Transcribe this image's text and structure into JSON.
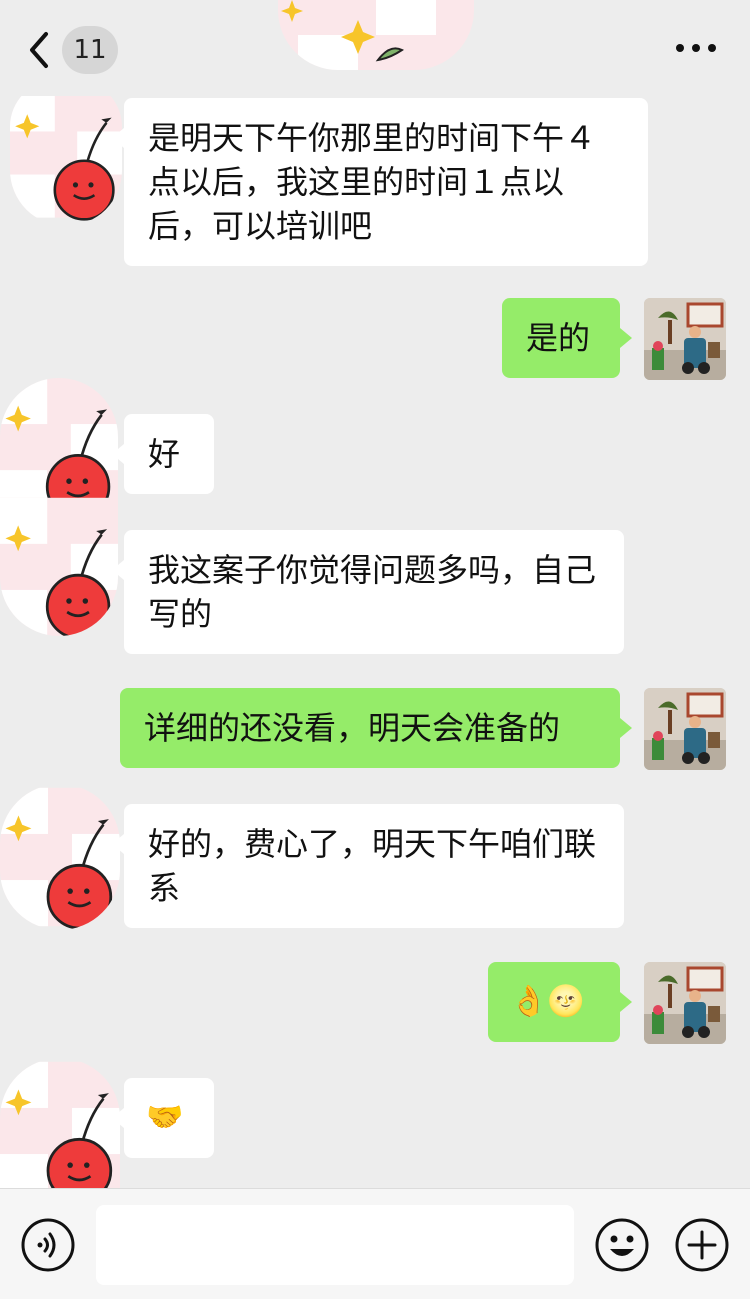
{
  "header": {
    "unread_count": "11",
    "back_icon": "chevron-left-icon",
    "more_icon": "more-dots-icon"
  },
  "messages": [
    {
      "side": "in",
      "text": "是明天下午你那里的时间下午４点以后，我这里的时间１点以后，可以培训吧"
    },
    {
      "side": "out",
      "text": "是的"
    },
    {
      "side": "in",
      "text": "好"
    },
    {
      "side": "in",
      "text": "我这案子你觉得问题多吗，自己写的"
    },
    {
      "side": "out",
      "text": "详细的还没看，明天会准备的"
    },
    {
      "side": "in",
      "text": "好的，费心了，明天下午咱们联系"
    },
    {
      "side": "out",
      "text": "👌🌝",
      "kind": "emoji"
    },
    {
      "side": "in",
      "text": "🤝",
      "kind": "emoji"
    }
  ],
  "input_bar": {
    "voice_icon": "voice-icon",
    "emoji_icon": "smiley-face-icon",
    "plus_icon": "plus-circle-icon",
    "placeholder": ""
  },
  "colors": {
    "background": "#ededed",
    "incoming_bubble": "#ffffff",
    "outgoing_bubble": "#95ec69"
  }
}
